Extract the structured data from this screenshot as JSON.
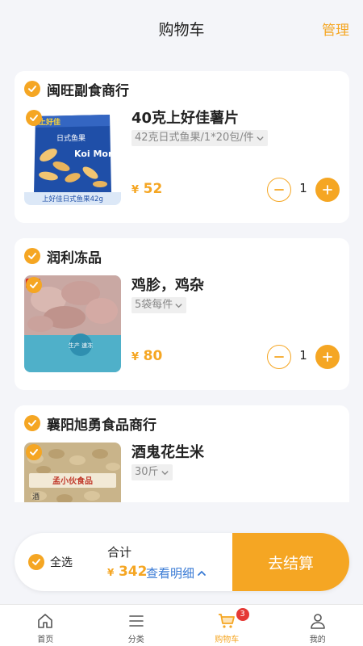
{
  "header": {
    "title": "购物车",
    "manage": "管理"
  },
  "cart": [
    {
      "store": "闽旺副食商行",
      "product": "40克上好佳薯片",
      "spec": "42克日式鱼果/1*20包/件",
      "image_caption": "上好佳日式鱼果42g",
      "image_brand": "上好佳",
      "image_text": "日式鱼果",
      "image_text2": "Koi Mori",
      "price_symbol": "¥",
      "price": "52",
      "quantity": "1"
    },
    {
      "store": "润利冻品",
      "product": "鸡胗，鸡杂",
      "spec": "5袋每件",
      "image_badge": "CP",
      "image_text": "生产 速冻",
      "price_symbol": "¥",
      "price": "80",
      "quantity": "1"
    },
    {
      "store": "襄阳旭勇食品商行",
      "product": "酒鬼花生米",
      "spec": "30斤",
      "image_text": "孟小伙食品",
      "image_text2": "酒",
      "price_symbol": "¥",
      "price": "",
      "quantity": ""
    }
  ],
  "checkout": {
    "select_all": "全选",
    "total_label": "合计",
    "total_symbol": "¥",
    "total": "342",
    "detail": "查看明细",
    "pay_button": "去结算"
  },
  "tabbar": {
    "items": [
      {
        "label": "首页",
        "icon": "home-icon"
      },
      {
        "label": "分类",
        "icon": "menu-icon"
      },
      {
        "label": "购物车",
        "icon": "cart-icon",
        "badge": "3"
      },
      {
        "label": "我的",
        "icon": "user-icon"
      }
    ]
  },
  "colors": {
    "accent": "#f5a623",
    "link": "#3a7bd5",
    "badge": "#e53935",
    "background": "#f4f5f9"
  }
}
